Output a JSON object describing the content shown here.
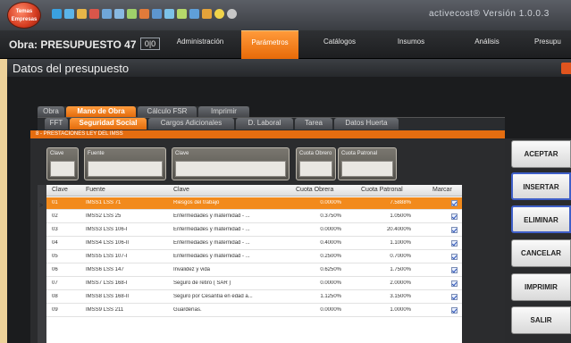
{
  "app": {
    "logo_text": "Temas Empresas",
    "version": "activecost®  Versión  1.0.0.3"
  },
  "menubar": {
    "obra_label": "Obra: PRESUPUESTO 47",
    "obra_num": "0|0",
    "items": [
      "Administración",
      "Parámetros",
      "Catálogos",
      "Insumos",
      "Análisis",
      "Presupu"
    ]
  },
  "window": {
    "title": "Datos del presupuesto"
  },
  "tabs": [
    "Obra",
    "Mano de Obra",
    "Cálculo FSR",
    "Imprimir"
  ],
  "subtabs": [
    "FFT",
    "Seguridad Social",
    "Cargos Adicionales",
    "D. Laboral",
    "Tarea",
    "Datos Huerta"
  ],
  "section": "8 - PRESTACIONES LEY DEL IMSS",
  "fields": [
    "Clave",
    "Fuente",
    "Clave",
    "Cuota Obrero",
    "Cuota Patronal"
  ],
  "grid": {
    "headers": [
      "Clave",
      "Fuente",
      "Clave",
      "Cuota Obrera",
      "Cuota Patronal",
      "Marcar"
    ],
    "rows": [
      {
        "clave": "01",
        "fuente": "IMSS1 LSS 71",
        "concepto": "Riesgos del trabajo",
        "obrera": "0.0000%",
        "patronal": "7.5888%",
        "selected": true
      },
      {
        "clave": "02",
        "fuente": "IMSS2 LSS 25",
        "concepto": "Enfermedades y maternidad - ...",
        "obrera": "0.3750%",
        "patronal": "1.0500%",
        "selected": false
      },
      {
        "clave": "03",
        "fuente": "IMSS3 LSS 106-I",
        "concepto": "Enfermedades y maternidad - ...",
        "obrera": "0.0000%",
        "patronal": "20.4000%",
        "selected": false
      },
      {
        "clave": "04",
        "fuente": "IMSS4 LSS 106-II",
        "concepto": "Enfermedades y maternidad - ...",
        "obrera": "0.4000%",
        "patronal": "1.1000%",
        "selected": false
      },
      {
        "clave": "05",
        "fuente": "IMSS5 LSS 107-I",
        "concepto": "Enfermedades y maternidad - ...",
        "obrera": "0.2500%",
        "patronal": "0.7000%",
        "selected": false
      },
      {
        "clave": "06",
        "fuente": "IMSS6 LSS 147",
        "concepto": "Invalidez y vida",
        "obrera": "0.6250%",
        "patronal": "1.7500%",
        "selected": false
      },
      {
        "clave": "07",
        "fuente": "IMSS7 LSS 168-I",
        "concepto": "Seguro de retiro ( SAR )",
        "obrera": "0.0000%",
        "patronal": "2.0000%",
        "selected": false
      },
      {
        "clave": "08",
        "fuente": "IMSS8 LSS 168-II",
        "concepto": "Seguro por Cesantía en edad a...",
        "obrera": "1.1250%",
        "patronal": "3.1500%",
        "selected": false
      },
      {
        "clave": "09",
        "fuente": "IMSS9 LSS 211",
        "concepto": "Guarderías.",
        "obrera": "0.0000%",
        "patronal": "1.0000%",
        "selected": false
      }
    ]
  },
  "buttons": {
    "aceptar": "ACEPTAR",
    "insertar": "INSERTAR",
    "eliminar": "ELIMINAR",
    "cancelar": "CANCELAR",
    "imprimir": "IMPRIMIR",
    "salir": "SALIR"
  }
}
